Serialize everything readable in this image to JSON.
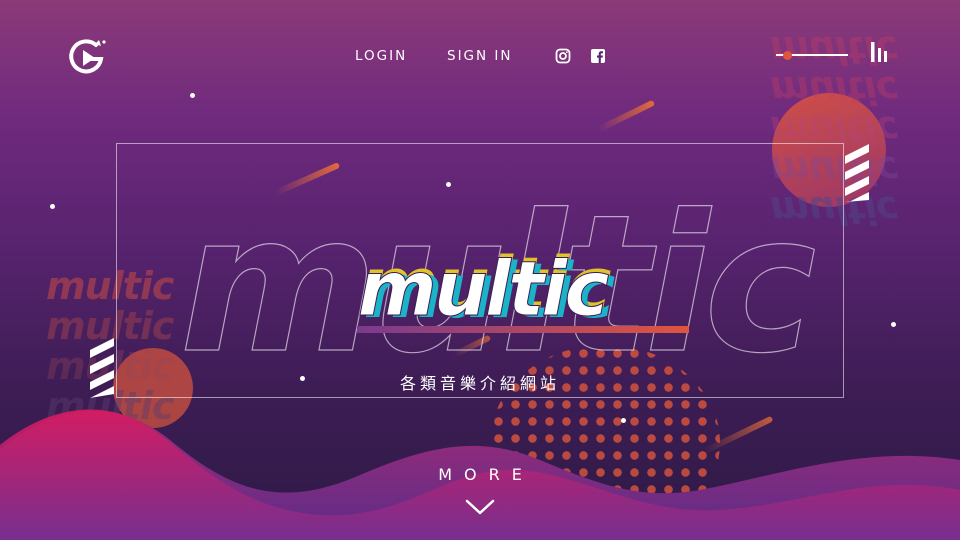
{
  "header": {
    "nav": {
      "login": "LOGIN",
      "sign_in": "SIGN IN"
    },
    "social_icons": [
      "instagram-icon",
      "facebook-icon"
    ],
    "volume_level": 0.15,
    "icons": {
      "logo": "play-flag-logo-icon",
      "music": "equalizer-bars-icon"
    }
  },
  "hero": {
    "title": "multic",
    "subtitle": "各類音樂介紹網站",
    "ghost_word": "multic"
  },
  "footer": {
    "more_label": "MORE",
    "more_icon": "chevron-down-icon"
  },
  "colors": {
    "accent": "#e0553d",
    "bar_start": "#7a3b8e",
    "wave": "#d81b60",
    "title_gold": "#e0c32a",
    "title_cyan": "#1ab3c8"
  }
}
